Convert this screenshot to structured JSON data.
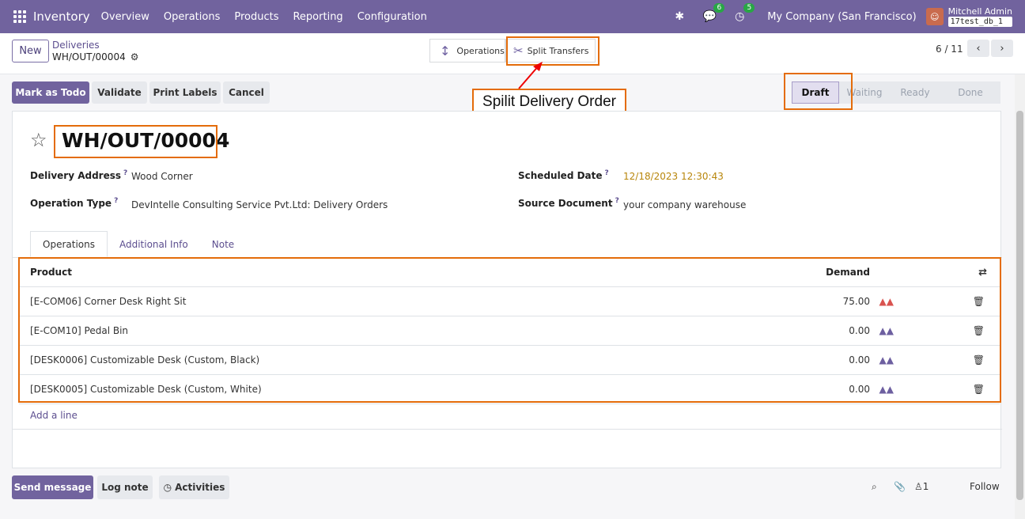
{
  "navbar": {
    "app_name": "Inventory",
    "menu": [
      "Overview",
      "Operations",
      "Products",
      "Reporting",
      "Configuration"
    ],
    "messages_badge": "6",
    "activities_badge": "5",
    "company": "My Company (San Francisco)",
    "user_name": "Mitchell Admin",
    "db_name": "17test_db_1"
  },
  "control_panel": {
    "new_label": "New",
    "breadcrumb_parent": "Deliveries",
    "breadcrumb_current": "WH/OUT/00004",
    "smart_operations": "Operations",
    "smart_split": "Split Transfers",
    "pager": "6 / 11"
  },
  "actions": {
    "mark_todo": "Mark as Todo",
    "validate": "Validate",
    "print_labels": "Print Labels",
    "cancel": "Cancel"
  },
  "statusbar": {
    "steps": [
      "Draft",
      "Waiting",
      "Ready",
      "Done"
    ],
    "active": "Draft"
  },
  "record": {
    "title": "WH/OUT/00004",
    "delivery_address_label": "Delivery Address",
    "delivery_address": "Wood Corner",
    "operation_type_label": "Operation Type",
    "operation_type": "DevIntelle Consulting Service Pvt.Ltd: Delivery Orders",
    "scheduled_date_label": "Scheduled Date",
    "scheduled_date": "12/18/2023 12:30:43",
    "source_document_label": "Source Document",
    "source_document": "your company warehouse",
    "help_mark": "?"
  },
  "tabs": [
    "Operations",
    "Additional Info",
    "Note"
  ],
  "lines": {
    "col_product": "Product",
    "col_demand": "Demand",
    "rows": [
      {
        "product": "[E-COM06] Corner Desk Right Sit",
        "demand": "75.00",
        "forecast_color": "#d9534f"
      },
      {
        "product": "[E-COM10] Pedal Bin",
        "demand": "0.00",
        "forecast_color": "#6d5fa0"
      },
      {
        "product": "[DESK0006] Customizable Desk (Custom, Black)",
        "demand": "0.00",
        "forecast_color": "#6d5fa0"
      },
      {
        "product": "[DESK0005] Customizable Desk (Custom, White)",
        "demand": "0.00",
        "forecast_color": "#6d5fa0"
      }
    ],
    "add_line": "Add a line"
  },
  "annotation": {
    "callout": "Spilit Delivery Order",
    "color": "#e46c0a"
  },
  "chatter": {
    "send_message": "Send message",
    "log_note": "Log note",
    "activities": "Activities",
    "followers_count": "1",
    "follow": "Follow"
  }
}
